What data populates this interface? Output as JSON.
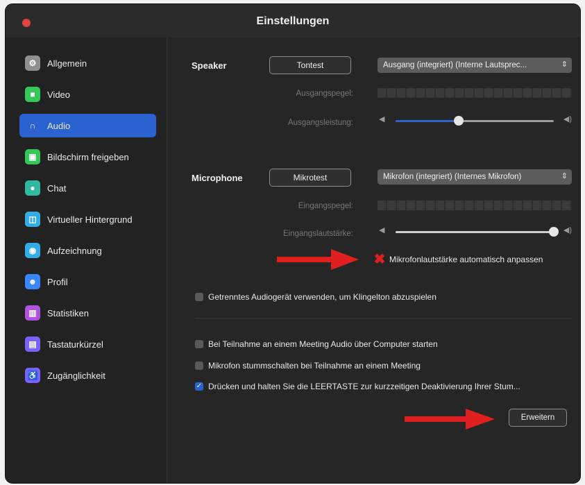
{
  "window": {
    "title": "Einstellungen"
  },
  "sidebar": {
    "items": [
      {
        "label": "Allgemein",
        "icon": "gear-icon",
        "color": "#8e8e93",
        "glyph": "⚙",
        "active": false
      },
      {
        "label": "Video",
        "icon": "video-camera-icon",
        "color": "#34c759",
        "glyph": "■",
        "active": false
      },
      {
        "label": "Audio",
        "icon": "headphones-icon",
        "color": "#2a63cf",
        "glyph": "∩",
        "active": true
      },
      {
        "label": "Bildschirm freigeben",
        "icon": "screen-share-icon",
        "color": "#34c759",
        "glyph": "▣",
        "active": false
      },
      {
        "label": "Chat",
        "icon": "chat-bubble-icon",
        "color": "#30b8a0",
        "glyph": "●",
        "active": false
      },
      {
        "label": "Virtueller Hintergrund",
        "icon": "background-image-icon",
        "color": "#32ade6",
        "glyph": "◫",
        "active": false
      },
      {
        "label": "Aufzeichnung",
        "icon": "record-icon",
        "color": "#32ade6",
        "glyph": "◉",
        "active": false
      },
      {
        "label": "Profil",
        "icon": "profile-icon",
        "color": "#3a86ff",
        "glyph": "☻",
        "active": false
      },
      {
        "label": "Statistiken",
        "icon": "statistics-icon",
        "color": "#af52de",
        "glyph": "▥",
        "active": false
      },
      {
        "label": "Tastaturkürzel",
        "icon": "keyboard-icon",
        "color": "#7b61ff",
        "glyph": "▤",
        "active": false
      },
      {
        "label": "Zugänglichkeit",
        "icon": "accessibility-icon",
        "color": "#7b61ff",
        "glyph": "♿",
        "active": false
      }
    ]
  },
  "speaker": {
    "label": "Speaker",
    "test_button": "Tontest",
    "device": "Ausgang (integriert) (Interne Lautsprec...",
    "output_level_label": "Ausgangspegel:",
    "output_volume_label": "Ausgangsleistung:",
    "output_volume_fraction": 0.4
  },
  "microphone": {
    "label": "Microphone",
    "test_button": "Mikrotest",
    "device": "Mikrofon (integriert) (Internes Mikrofon)",
    "input_level_label": "Eingangspegel:",
    "input_volume_label": "Eingangslautstärke:",
    "input_volume_fraction": 1.0,
    "auto_adjust_label": "Mikrofonlautstärke automatisch anpassen",
    "auto_adjust_checked": true
  },
  "options": {
    "separate_device_label": "Getrenntes Audiogerät verwenden, um Klingelton abzuspielen",
    "separate_device_checked": false,
    "join_audio_label": "Bei Teilnahme an einem Meeting Audio über Computer starten",
    "join_audio_checked": false,
    "mute_mic_label": "Mikrofon stummschalten bei Teilnahme an einem Meeting",
    "mute_mic_checked": false,
    "push_to_talk_label": "Drücken und halten Sie die LEERTASTE zur kurzzeitigen Deaktivierung Ihrer Stum...",
    "push_to_talk_checked": true
  },
  "advanced_button": "Erweitern",
  "colors": {
    "accent": "#2a63cf",
    "annotation_arrow": "#e02020"
  }
}
